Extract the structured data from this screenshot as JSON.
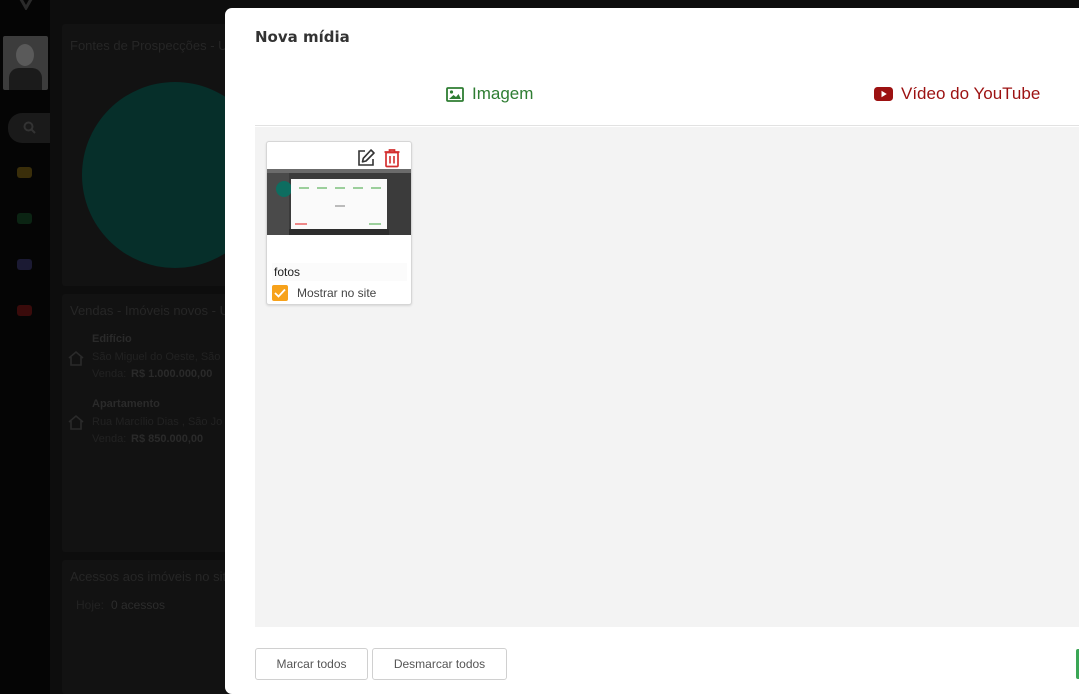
{
  "background": {
    "cards": [
      {
        "title": "Fontes de Prospecções - U"
      },
      {
        "title": "Vendas - Imóveis novos - U"
      },
      {
        "title": "Acessos aos imóveis no sit"
      }
    ],
    "listings": [
      {
        "type": "Edifício",
        "address": "São Miguel do Oeste, São",
        "price_label": "Venda:",
        "price": "R$ 1.000.000,00"
      },
      {
        "type": "Apartamento",
        "address": "Rua Marcílio Dias , São Jo",
        "price_label": "Venda:",
        "price": "R$ 850.000,00"
      }
    ],
    "visits": {
      "label": "Hoje:",
      "value": "0 acessos"
    }
  },
  "modal": {
    "title": "Nova mídia",
    "tabs": [
      {
        "label": "Imagem",
        "icon": "image-icon",
        "color": "#2e7d32"
      },
      {
        "label": "Vídeo do YouTube",
        "icon": "youtube-icon",
        "color": "#9c1111"
      }
    ],
    "media": [
      {
        "caption": "fotos",
        "show_on_site_label": "Mostrar no site",
        "show_on_site": true
      }
    ],
    "footer": {
      "mark_all": "Marcar todos",
      "unmark_all": "Desmarcar todos"
    }
  },
  "colors": {
    "accent_orange": "#f7a21b",
    "delete_red": "#d32f2f",
    "success_green": "#3aa655"
  }
}
